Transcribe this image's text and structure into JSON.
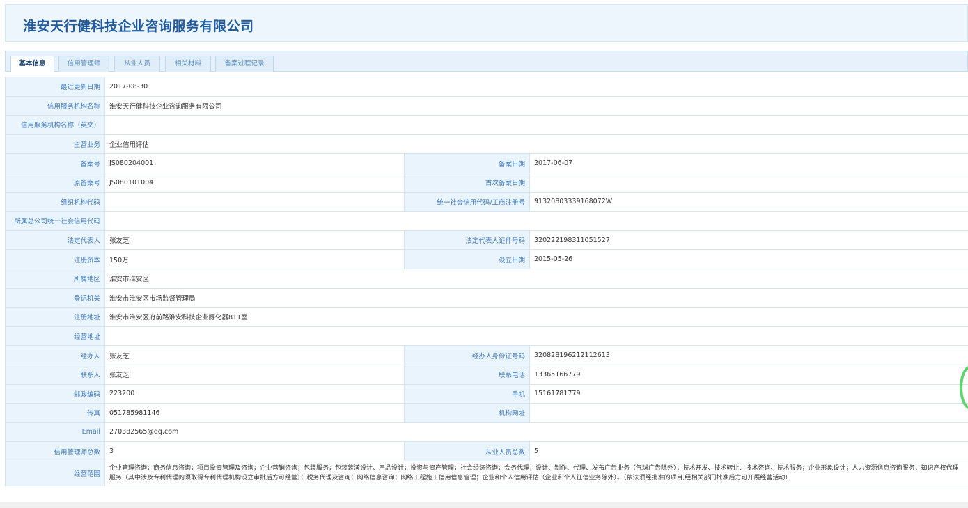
{
  "header": {
    "company_title": "淮安天行健科技企业咨询服务有限公司"
  },
  "tabs": [
    {
      "label": "基本信息",
      "active": true
    },
    {
      "label": "信用管理师",
      "active": false
    },
    {
      "label": "从业人员",
      "active": false
    },
    {
      "label": "相关材料",
      "active": false
    },
    {
      "label": "备案过程记录",
      "active": false
    }
  ],
  "fields": {
    "update_date": {
      "label": "最近更新日期",
      "value": "2017-08-30"
    },
    "org_name": {
      "label": "信用服务机构名称",
      "value": "淮安天行健科技企业咨询服务有限公司"
    },
    "org_name_en": {
      "label": "信用服务机构名称（英文）",
      "value": ""
    },
    "main_business": {
      "label": "主营业务",
      "value": "企业信用评估"
    },
    "filing_no": {
      "label": "备案号",
      "value": "JS080204001"
    },
    "filing_date": {
      "label": "备案日期",
      "value": "2017-06-07"
    },
    "orig_filing_no": {
      "label": "原备案号",
      "value": "JS080101004"
    },
    "first_filing_date": {
      "label": "首次备案日期",
      "value": ""
    },
    "org_code": {
      "label": "组织机构代码",
      "value": ""
    },
    "credit_code": {
      "label": "统一社会信用代码/工商注册号",
      "value": "91320803339168072W"
    },
    "parent_credit_code": {
      "label": "所属总公司统一社会信用代码",
      "value": ""
    },
    "legal_rep": {
      "label": "法定代表人",
      "value": "张友芝"
    },
    "legal_rep_id": {
      "label": "法定代表人证件号码",
      "value": "320222198311051527"
    },
    "reg_capital": {
      "label": "注册资本",
      "value": "150万"
    },
    "founded_date": {
      "label": "设立日期",
      "value": "2015-05-26"
    },
    "region": {
      "label": "所属地区",
      "value": "淮安市淮安区"
    },
    "reg_authority": {
      "label": "登记机关",
      "value": "淮安市淮安区市场监督管理局"
    },
    "reg_address": {
      "label": "注册地址",
      "value": "淮安市淮安区府前路淮安科技企业孵化器811室"
    },
    "biz_address": {
      "label": "经营地址",
      "value": ""
    },
    "handler": {
      "label": "经办人",
      "value": "张友芝"
    },
    "handler_id": {
      "label": "经办人身份证号码",
      "value": "320828196212112613"
    },
    "contact": {
      "label": "联系人",
      "value": "张友芝"
    },
    "phone": {
      "label": "联系电话",
      "value": "13365166779"
    },
    "postcode": {
      "label": "邮政编码",
      "value": "223200"
    },
    "mobile": {
      "label": "手机",
      "value": "15161781779"
    },
    "fax": {
      "label": "传真",
      "value": "051785981146"
    },
    "website": {
      "label": "机构网址",
      "value": ""
    },
    "email": {
      "label": "Email",
      "value": "270382565@qq.com"
    },
    "credit_mgr_total": {
      "label": "信用管理师总数",
      "value": "3"
    },
    "staff_total": {
      "label": "从业人员总数",
      "value": "5"
    },
    "biz_scope": {
      "label": "经营范围",
      "value": "企业管理咨询；商务信息咨询；项目投资管理及咨询；企业营销咨询；包装服务；包装装潢设计、产品设计；投资与资产管理；社会经济咨询；会务代理；设计、制作、代理、发布广告业务（气球广告除外）；技术开发、技术转让、技术咨询、技术服务；企业形象设计；人力资源信息咨询服务；知识产权代理服务（其中涉及专利代理的须取得专利代理机构设立审批后方可经营）；税务代理及咨询；网络信息咨询；网络工程施工信用信息管理；企业和个人信用评估（企业和个人征信业务除外）。（依法须经批准的项目,经相关部门批准后方可开展经营活动）"
    }
  }
}
